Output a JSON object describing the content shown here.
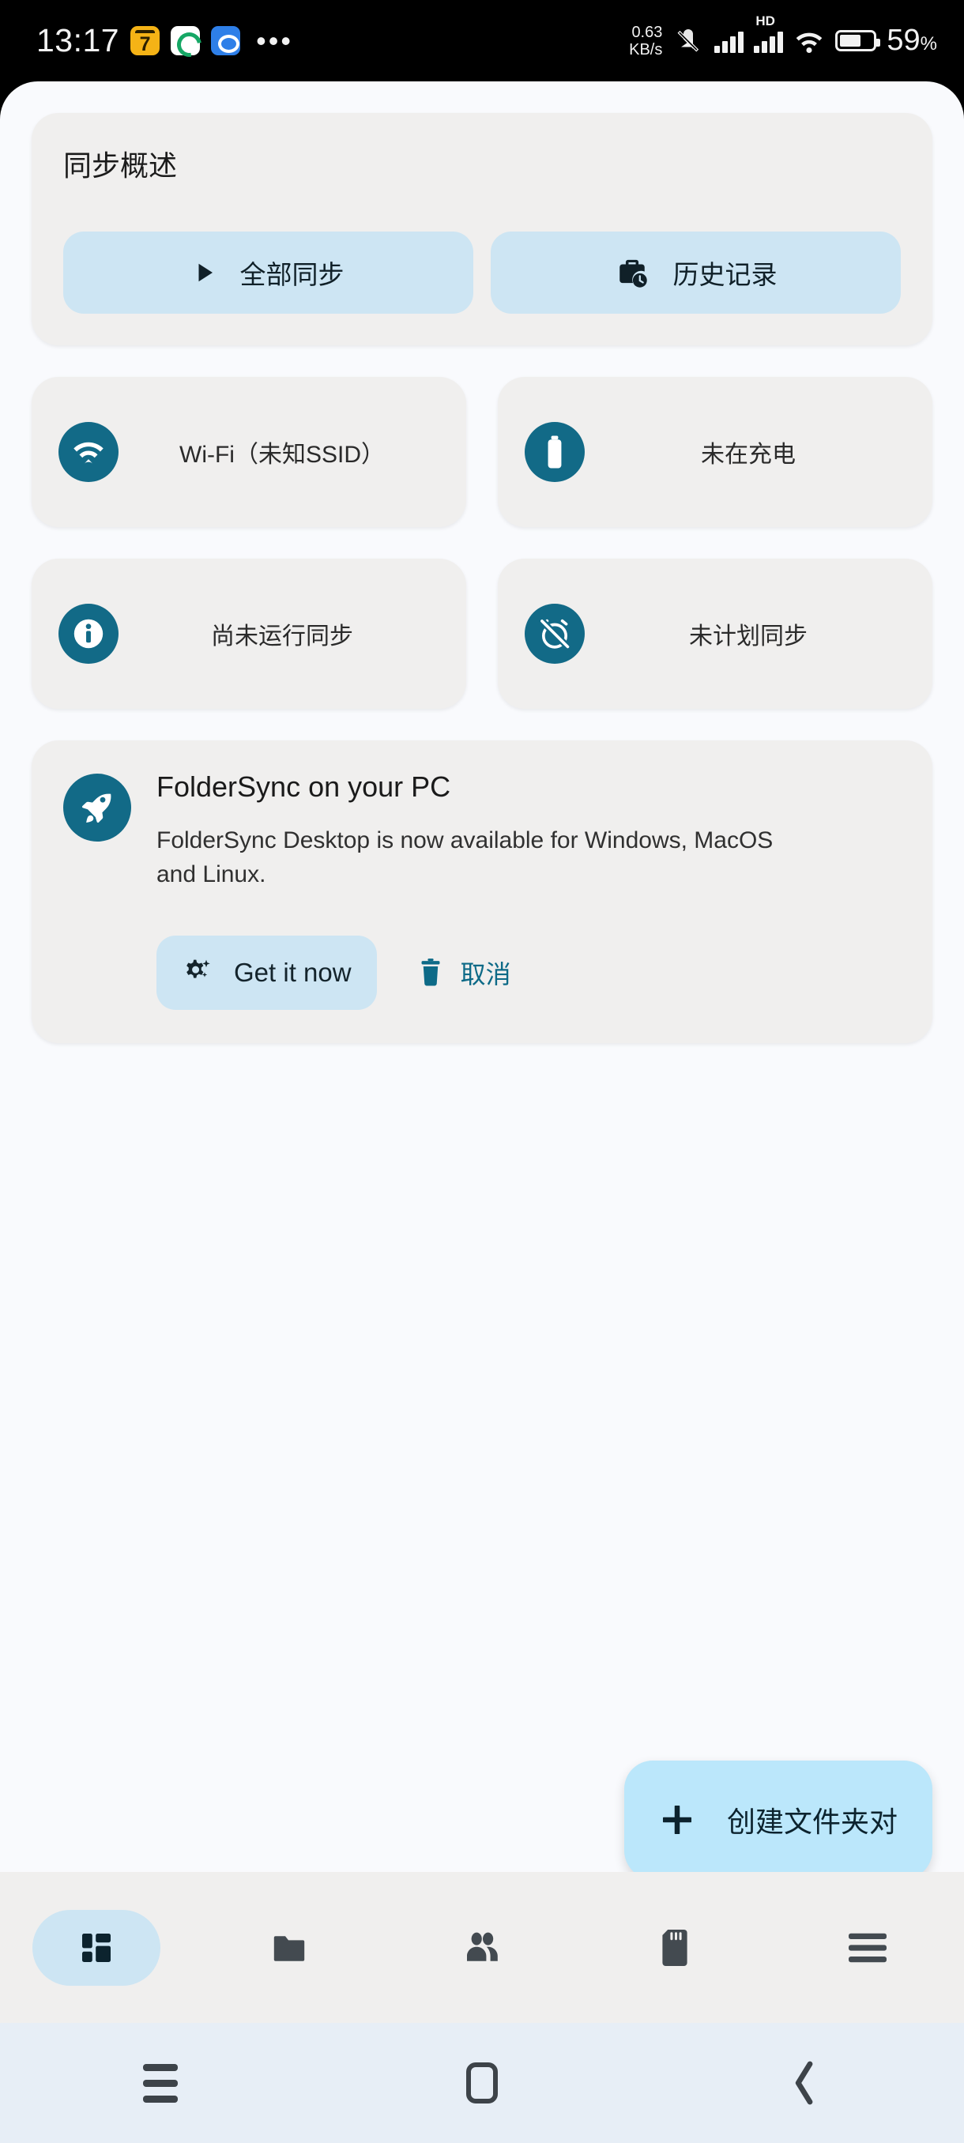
{
  "status_bar": {
    "time": "13:17",
    "overflow": "•••",
    "net_speed_value": "0.63",
    "net_speed_unit": "KB/s",
    "hd_label": "HD",
    "battery_percent": "59",
    "percent_sign": "%",
    "app_icons": [
      "cat-seven-app-icon",
      "green-spiral-app-icon",
      "blue-cloud-app-icon"
    ],
    "icons": [
      "mute-icon",
      "signal-bars-icon",
      "hd-icon",
      "signal-bars-2-icon",
      "wifi-icon",
      "battery-icon"
    ]
  },
  "overview": {
    "title": "同步概述",
    "sync_all_label": "全部同步",
    "history_label": "历史记录"
  },
  "status_cards": [
    {
      "label": "Wi-Fi（未知SSID）",
      "icon": "wifi-icon"
    },
    {
      "label": "未在充电",
      "icon": "battery-icon"
    },
    {
      "label": "尚未运行同步",
      "icon": "info-icon"
    },
    {
      "label": "未计划同步",
      "icon": "alarm-off-icon"
    }
  ],
  "promo": {
    "title": "FolderSync on your PC",
    "description": "FolderSync Desktop is now available for Windows, MacOS and Linux.",
    "get_label": "Get it now",
    "cancel_label": "取消",
    "icon": "rocket-icon"
  },
  "fab": {
    "label": "创建文件夹对",
    "icon": "plus-icon"
  },
  "bottom_nav": [
    {
      "name": "dashboard",
      "icon": "dashboard-icon",
      "active": true
    },
    {
      "name": "folderpairs",
      "icon": "folder-icon",
      "active": false
    },
    {
      "name": "accounts",
      "icon": "people-icon",
      "active": false
    },
    {
      "name": "storage",
      "icon": "sdcard-icon",
      "active": false
    },
    {
      "name": "menu",
      "icon": "hamburger-icon",
      "active": false
    }
  ],
  "system_nav": [
    {
      "name": "recents",
      "icon": "recents-icon"
    },
    {
      "name": "home",
      "icon": "home-icon"
    },
    {
      "name": "back",
      "icon": "back-icon"
    }
  ],
  "colors": {
    "accent_teal": "#126a87",
    "pill_blue": "#cde5f3",
    "fab_blue": "#bbe7fb",
    "card_gray": "#f0efee",
    "page_bg": "#f9fafd",
    "sysnav_bg": "#e7eef6"
  }
}
